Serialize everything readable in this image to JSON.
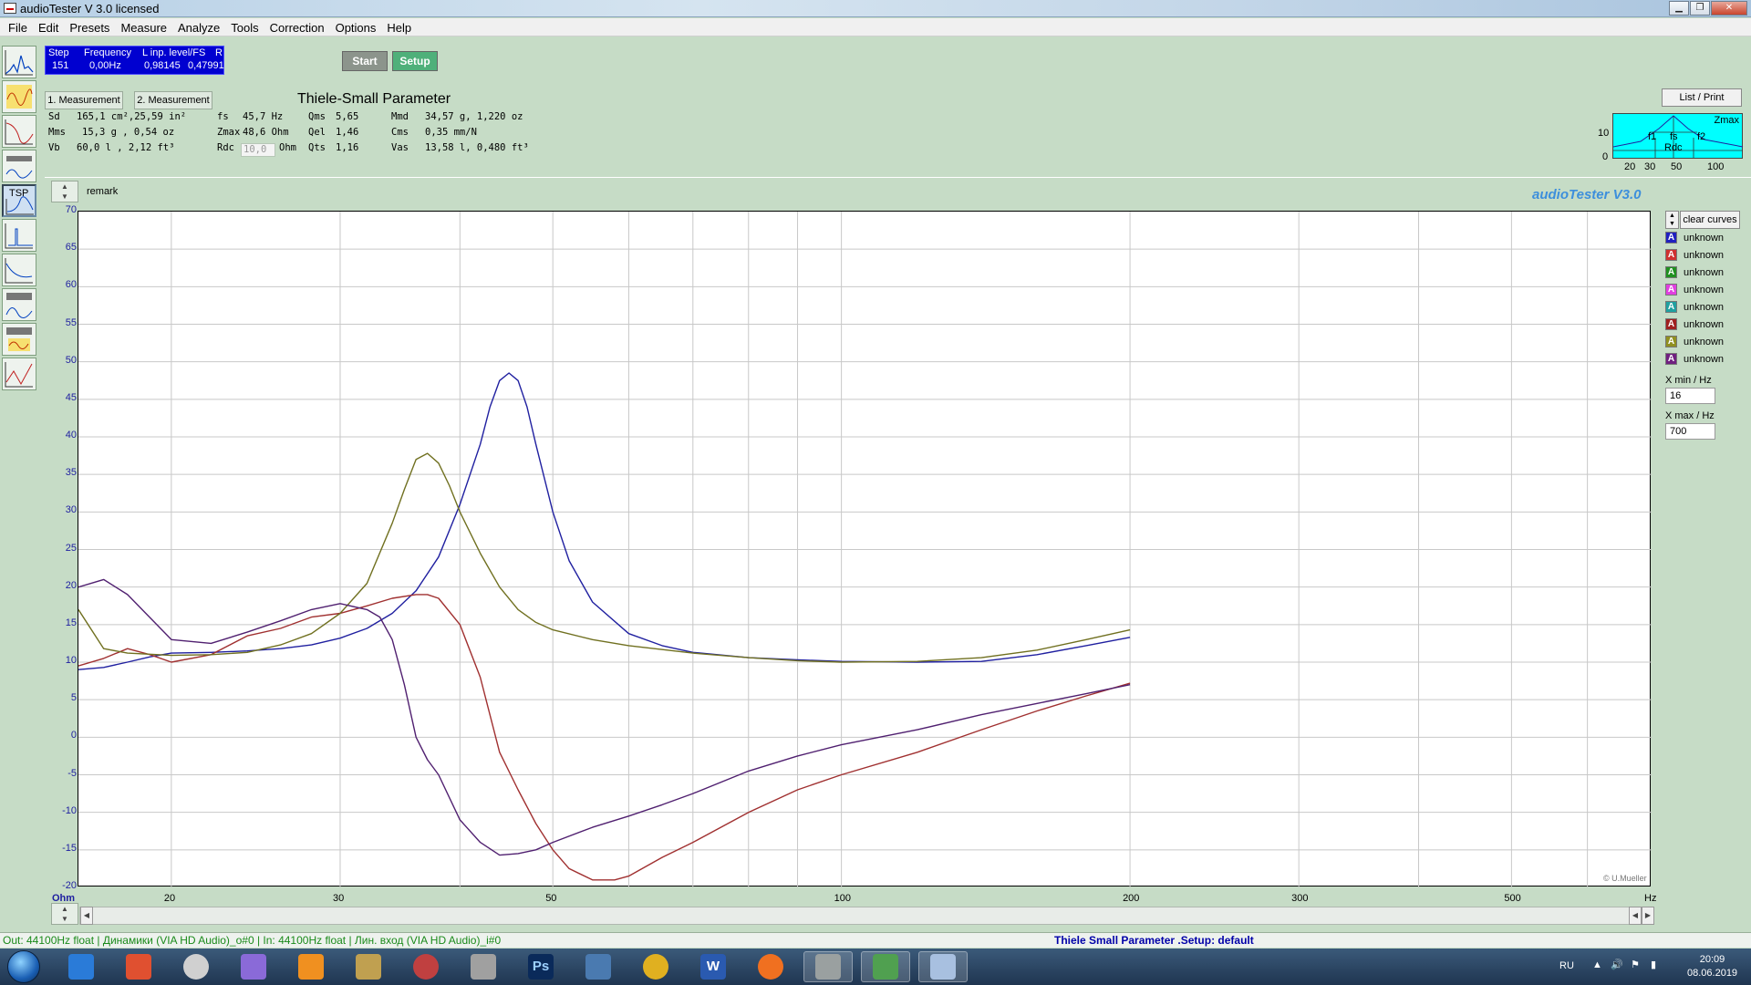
{
  "window": {
    "title": "audioTester  V 3.0   licensed"
  },
  "menu": [
    "File",
    "Edit",
    "Presets",
    "Measure",
    "Analyze",
    "Tools",
    "Correction",
    "Options",
    "Help"
  ],
  "step_panel": {
    "headers": [
      "Step",
      "Frequency",
      "L inp. level/FS",
      "R"
    ],
    "values": [
      "151",
      "0,00Hz",
      "0,98145",
      "0,47991"
    ]
  },
  "buttons": {
    "start": "Start",
    "setup": "Setup",
    "meas1": "1. Measurement",
    "meas2": "2. Measurement",
    "list_print": "List / Print",
    "clear_curves": "clear curves"
  },
  "tsp": {
    "title": "Thiele-Small Parameter",
    "col1": [
      {
        "label": "Sd",
        "value": "165,1 cm²,25,59 in²"
      },
      {
        "label": "Mms",
        "value": "15,3 g  , 0,54 oz"
      },
      {
        "label": "Vb",
        "value": " 60,0 l  , 2,12 ft³"
      }
    ],
    "col2": [
      {
        "label": "fs",
        "value": "45,7 Hz"
      },
      {
        "label": "Zmax",
        "value": "48,6 Ohm"
      },
      {
        "label": "Rdc",
        "value": "10,0",
        "unit": "Ohm"
      }
    ],
    "col3": [
      {
        "label": "Qms",
        "value": "5,65"
      },
      {
        "label": "Qel",
        "value": "1,46"
      },
      {
        "label": "Qts",
        "value": "1,16"
      }
    ],
    "col4": [
      {
        "label": "Mmd",
        "value": "34,57 g, 1,220 oz"
      },
      {
        "label": "Cms",
        "value": "  0,35 mm/N"
      },
      {
        "label": "Vas",
        "value": " 13,58 l, 0,480 ft³"
      }
    ]
  },
  "mini_graph": {
    "labels": [
      "Zmax",
      "f1",
      "fs",
      "f2",
      "Rdc"
    ],
    "y_ticks": [
      "10",
      "0"
    ],
    "x_ticks": [
      "20",
      "30",
      "50",
      "100"
    ]
  },
  "remark": "remark",
  "brand": "audioTester  V3.0",
  "copyright": "© U.Mueller",
  "chart_data": {
    "type": "line",
    "xscale": "log",
    "xlim": [
      16,
      700
    ],
    "ylim": [
      -20,
      70
    ],
    "ylabel": "Ohm",
    "xlabel": "Hz",
    "x_ticks": [
      "20",
      "30",
      "50",
      "100",
      "200",
      "300",
      "500"
    ],
    "y_ticks": [
      "70",
      "65",
      "60",
      "55",
      "50",
      "45",
      "40",
      "35",
      "30",
      "25",
      "20",
      "15",
      "10",
      "5",
      "0",
      "-5",
      "-10",
      "-15",
      "-20"
    ],
    "grid": true,
    "series": [
      {
        "name": "unknown",
        "color": "#2020a0",
        "x": [
          16,
          17,
          18,
          19,
          20,
          22,
          24,
          26,
          28,
          30,
          32,
          34,
          36,
          38,
          40,
          42,
          43,
          44,
          45,
          46,
          47,
          48,
          50,
          52,
          55,
          60,
          65,
          70,
          80,
          90,
          100,
          120,
          140,
          160,
          180,
          200
        ],
        "y": [
          9,
          9.3,
          10,
          10.7,
          11.2,
          11.3,
          11.5,
          11.8,
          12.3,
          13.2,
          14.5,
          16.5,
          19.5,
          24,
          31,
          39,
          44,
          47.5,
          48.5,
          47.5,
          44,
          39,
          30,
          23.5,
          18,
          13.8,
          12.2,
          11.3,
          10.6,
          10.3,
          10.1,
          10.0,
          10.1,
          11.0,
          12.2,
          13.3
        ]
      },
      {
        "name": "unknown",
        "color": "#a03030",
        "x": [
          16,
          17,
          18,
          19,
          20,
          22,
          24,
          26,
          28,
          30,
          32,
          34,
          36,
          37,
          38,
          40,
          42,
          44,
          46,
          48,
          50,
          52,
          55,
          58,
          60,
          65,
          70,
          80,
          90,
          100,
          120,
          140,
          160,
          180,
          200
        ],
        "y": [
          9.5,
          10.5,
          11.8,
          11,
          10,
          11,
          13.5,
          14.5,
          16,
          16.5,
          17.5,
          18.5,
          19,
          19,
          18.5,
          15,
          8,
          -2,
          -7,
          -11.5,
          -15,
          -17.5,
          -19,
          -19,
          -18.5,
          -16,
          -14,
          -10,
          -7,
          -5,
          -2,
          1,
          3.5,
          5.5,
          7.2
        ]
      },
      {
        "name": "unknown",
        "color": "#707020",
        "x": [
          16,
          17,
          18,
          20,
          22,
          24,
          26,
          28,
          30,
          32,
          34,
          35,
          36,
          37,
          38,
          39,
          40,
          42,
          44,
          46,
          48,
          50,
          55,
          60,
          70,
          80,
          90,
          100,
          120,
          140,
          160,
          180,
          200
        ],
        "y": [
          17,
          11.8,
          11.2,
          10.9,
          11,
          11.3,
          12.3,
          13.8,
          16.5,
          20.5,
          28.5,
          33,
          37,
          37.8,
          36.5,
          33.5,
          30,
          24.5,
          20,
          17,
          15.3,
          14.3,
          13,
          12.2,
          11.2,
          10.6,
          10.2,
          10.0,
          10.1,
          10.6,
          11.6,
          13,
          14.3
        ]
      },
      {
        "name": "unknown",
        "color": "#502070",
        "x": [
          16,
          17,
          18,
          20,
          22,
          24,
          26,
          28,
          30,
          32,
          33,
          34,
          35,
          36,
          37,
          38,
          40,
          42,
          44,
          46,
          48,
          50,
          55,
          60,
          65,
          70,
          80,
          90,
          100,
          120,
          140,
          160,
          180,
          200
        ],
        "y": [
          20,
          21,
          19,
          13,
          12.5,
          14,
          15.5,
          17,
          17.8,
          17,
          16,
          13,
          7,
          0,
          -3,
          -5,
          -11,
          -14,
          -15.7,
          -15.5,
          -15,
          -14,
          -12,
          -10.5,
          -9,
          -7.5,
          -4.5,
          -2.5,
          -1,
          1,
          3,
          4.5,
          5.8,
          7
        ]
      }
    ]
  },
  "curves": [
    {
      "label": "unknown",
      "color": "#2020c0"
    },
    {
      "label": "unknown",
      "color": "#d03030"
    },
    {
      "label": "unknown",
      "color": "#209020"
    },
    {
      "label": "unknown",
      "color": "#e040e0"
    },
    {
      "label": "unknown",
      "color": "#20a0a0"
    },
    {
      "label": "unknown",
      "color": "#a02020"
    },
    {
      "label": "unknown",
      "color": "#909020"
    },
    {
      "label": "unknown",
      "color": "#702080"
    }
  ],
  "x_inputs": {
    "xmin_label": "X min / Hz",
    "xmin_value": "16",
    "xmax_label": "X max / Hz",
    "xmax_value": "700"
  },
  "status": {
    "left": "Out: 44100Hz float  | Динамики (VIA HD Audio)_o#0  | In: 44100Hz float  | Лин. вход (VIA HD Audio)_i#0",
    "right": "Thiele Small Parameter .Setup:  default"
  },
  "taskbar": {
    "lang": "RU",
    "time": "20:09",
    "date": "08.06.2019",
    "icons": [
      "ie-icon",
      "winamp-icon",
      "media-icon",
      "arc-icon",
      "video-icon",
      "feather-icon",
      "ball-icon",
      "archive-icon",
      "photoshop-icon",
      "calculator-icon",
      "chrome-icon",
      "word-icon",
      "firefox-icon",
      "audio-icon",
      "green-app-icon",
      "audiotester-icon"
    ],
    "ps_label": "Ps",
    "word_label": "W"
  }
}
